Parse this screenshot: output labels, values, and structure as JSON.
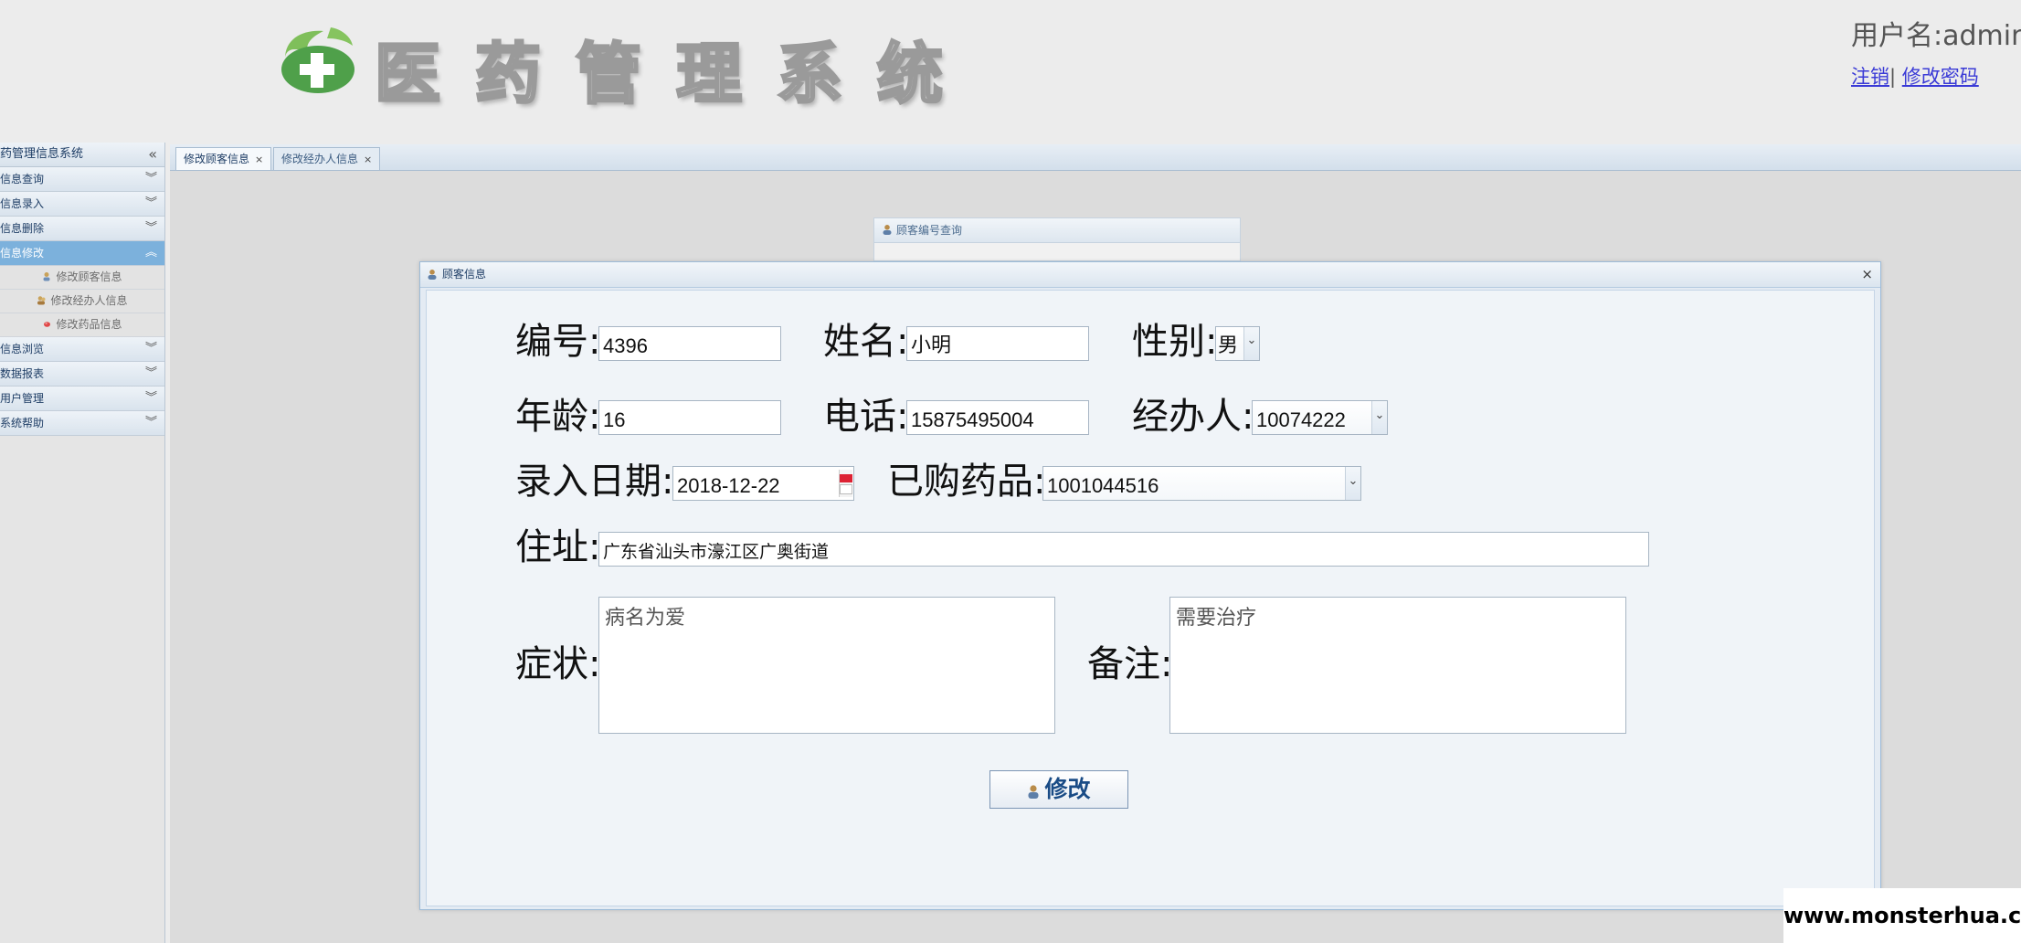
{
  "header": {
    "app_title": "医药管理系统",
    "user_prefix": "用户名:",
    "username": "admin",
    "logout_link": "注销",
    "separator": "|",
    "change_password_link": "修改密码"
  },
  "sidebar": {
    "title": "药管理信息系统",
    "collapse_glyph": "«",
    "sections": [
      {
        "label": "信息查询"
      },
      {
        "label": "信息录入"
      },
      {
        "label": "信息删除"
      },
      {
        "label": "信息修改"
      },
      {
        "label": "信息浏览"
      },
      {
        "label": "数据报表"
      },
      {
        "label": "用户管理"
      },
      {
        "label": "系统帮助"
      }
    ],
    "modify_items": [
      {
        "label": "修改顾客信息"
      },
      {
        "label": "修改经办人信息"
      },
      {
        "label": "修改药品信息"
      }
    ]
  },
  "tabs": [
    {
      "label": "修改顾客信息"
    },
    {
      "label": "修改经办人信息"
    }
  ],
  "query_panel": {
    "title": "顾客编号查询"
  },
  "dialog": {
    "title": "顾客信息",
    "close_glyph": "×",
    "fields": {
      "id": {
        "label": "编号:",
        "value": "4396"
      },
      "name": {
        "label": "姓名:",
        "value": "小明"
      },
      "gender": {
        "label": "性别:",
        "value": "男"
      },
      "age": {
        "label": "年龄:",
        "value": "16"
      },
      "phone": {
        "label": "电话:",
        "value": "15875495004"
      },
      "handler": {
        "label": "经办人:",
        "value": "10074222"
      },
      "entry_date": {
        "label": "录入日期:",
        "value": "2018-12-22"
      },
      "purchased_drug": {
        "label": "已购药品:",
        "value": "1001044516"
      },
      "address": {
        "label": "住址:",
        "value": "广东省汕头市濠江区广奥街道"
      },
      "symptom": {
        "label": "症状:",
        "value": "病名为爱"
      },
      "remark": {
        "label": "备注:",
        "value": "需要治疗"
      }
    },
    "submit_label": "修改"
  },
  "watermark": "www.monsterhua.com",
  "colors": {
    "accent_active_section": "#7cb1dc",
    "link": "#3a3ad6",
    "button_text": "#1a4c86"
  }
}
